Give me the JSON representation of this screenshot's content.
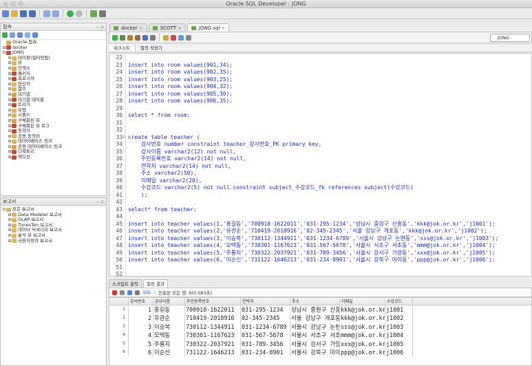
{
  "window": {
    "title": "Oracle SQL Developer : JONG"
  },
  "connections_panel": {
    "title": "접속",
    "tree": [
      {
        "label": "Oracle 접속",
        "level": 0,
        "toggle": "",
        "icon": "folder-icon"
      },
      {
        "label": "docker",
        "level": 0,
        "toggle": "+",
        "icon": "db-icon"
      },
      {
        "label": "JONG",
        "level": 0,
        "toggle": "-",
        "icon": "db-icon"
      },
      {
        "label": "테이블(필터링됨)",
        "level": 1,
        "toggle": "+",
        "icon": "folder-icon"
      },
      {
        "label": "뷰",
        "level": 1,
        "toggle": "+",
        "icon": "folder-icon"
      },
      {
        "label": "인덱스",
        "level": 1,
        "toggle": "+",
        "icon": "folder-icon"
      },
      {
        "label": "패키지",
        "level": 1,
        "toggle": "+",
        "icon": "folder-icon"
      },
      {
        "label": "프로시저",
        "level": 1,
        "toggle": "+",
        "icon": "folder-icon"
      },
      {
        "label": "연산자",
        "level": 1,
        "toggle": "+",
        "icon": "folder-icon"
      },
      {
        "label": "함수",
        "level": 1,
        "toggle": "+",
        "icon": "folder-icon"
      },
      {
        "label": "대기열",
        "level": 1,
        "toggle": "+",
        "icon": "folder-icon"
      },
      {
        "label": "대기열 테이블",
        "level": 1,
        "toggle": "+",
        "icon": "folder-icon"
      },
      {
        "label": "트리거",
        "level": 1,
        "toggle": "+",
        "icon": "folder-icon"
      },
      {
        "label": "유형",
        "level": 1,
        "toggle": "+",
        "icon": "folder-icon"
      },
      {
        "label": "시퀀스",
        "level": 1,
        "toggle": "+",
        "icon": "folder-icon"
      },
      {
        "label": "구체화된 뷰",
        "level": 1,
        "toggle": "+",
        "icon": "folder-icon"
      },
      {
        "label": "구체화된 뷰 로그",
        "level": 1,
        "toggle": "+",
        "icon": "folder-icon"
      },
      {
        "label": "동의어",
        "level": 1,
        "toggle": "+",
        "icon": "folder-icon"
      },
      {
        "label": "공용 동의어",
        "level": 1,
        "toggle": "+",
        "icon": "folder-icon"
      },
      {
        "label": "데이터베이스 링크",
        "level": 1,
        "toggle": "+",
        "icon": "folder-icon"
      },
      {
        "label": "공용 데이터베이스 링크",
        "level": 1,
        "toggle": "+",
        "icon": "folder-icon"
      },
      {
        "label": "디렉토리",
        "level": 1,
        "toggle": "+",
        "icon": "folder-icon"
      },
      {
        "label": "에디션",
        "level": 1,
        "toggle": "+",
        "icon": "folder-icon"
      }
    ]
  },
  "reports_panel": {
    "title": "보고서",
    "tree": [
      {
        "label": "모든 보고서",
        "level": 0,
        "toggle": "-"
      },
      {
        "label": "Data Modeler 보고서",
        "level": 1,
        "toggle": "+"
      },
      {
        "label": "OLAP 보고서",
        "level": 1,
        "toggle": "+"
      },
      {
        "label": "TimesTen 보고서",
        "level": 1,
        "toggle": "+"
      },
      {
        "label": "데이터 딕셔너리 보고서",
        "level": 1,
        "toggle": "+"
      },
      {
        "label": "분석 뷰 보고서",
        "level": 1,
        "toggle": "+"
      },
      {
        "label": "사용자정의 보고서",
        "level": 1,
        "toggle": "+"
      }
    ]
  },
  "editor_tabs": [
    {
      "label": "docker",
      "active": false
    },
    {
      "label": "SCOTT",
      "active": false
    },
    {
      "label": "JONG.sql",
      "active": true
    }
  ],
  "connection_select": "JONG",
  "editor_subtabs": [
    "워크시트",
    "질의 작성기"
  ],
  "code_lines": [
    {
      "n": "22",
      "fold": "",
      "text": ""
    },
    {
      "n": "23",
      "fold": "",
      "text": "insert into room values(901,34);"
    },
    {
      "n": "24",
      "fold": "",
      "text": "insert into room values(902,35);"
    },
    {
      "n": "25",
      "fold": "",
      "text": "insert into room values(903,25);"
    },
    {
      "n": "26",
      "fold": "",
      "text": "insert into room values(904,32);"
    },
    {
      "n": "27",
      "fold": "",
      "text": "insert into room values(905,30);"
    },
    {
      "n": "28",
      "fold": "",
      "text": "insert into room values(906,35);"
    },
    {
      "n": "29",
      "fold": "",
      "text": ""
    },
    {
      "n": "30",
      "fold": "",
      "text": "select * from room;"
    },
    {
      "n": "31",
      "fold": "",
      "text": ""
    },
    {
      "n": "32",
      "fold": "",
      "text": ""
    },
    {
      "n": "33",
      "fold": "⊟",
      "text": "create table teacher ("
    },
    {
      "n": "34",
      "fold": "",
      "text": "    강사번호 number constraint teacher_강사번호_PK primary key,"
    },
    {
      "n": "35",
      "fold": "",
      "text": "    강사이름 varchar2(12) not null,"
    },
    {
      "n": "36",
      "fold": "",
      "text": "    주민등록번호 varchar2(14) not null,"
    },
    {
      "n": "37",
      "fold": "",
      "text": "    연락처 varchar2(14) not null,"
    },
    {
      "n": "38",
      "fold": "",
      "text": "    주소 varchar2(50),"
    },
    {
      "n": "39",
      "fold": "",
      "text": "    이메일 varchar2(20),"
    },
    {
      "n": "40",
      "fold": "",
      "text": "    수강코드 varchar2(5) not null constraint subject_수강코드_fk references subject(수강코드)"
    },
    {
      "n": "41",
      "fold": "",
      "text": "    );"
    },
    {
      "n": "42",
      "fold": "",
      "text": ""
    },
    {
      "n": "43",
      "fold": "",
      "text": "select* from teacher;"
    },
    {
      "n": "44",
      "fold": "",
      "text": ""
    },
    {
      "n": "45",
      "fold": "",
      "text": "insert into teacher values(1,'홍길동','700918-1622011','031-295-1234','성남시 중원구 신흥동','kkk@jok.or.kr','j1001');"
    },
    {
      "n": "46",
      "fold": "",
      "text": "insert into teacher values(2,'유관순','710419-2018916','02-345-2345','서울 강남구 개포동','kkk@jok.or.kr','j1002');"
    },
    {
      "n": "47",
      "fold": "",
      "text": "insert into teacher values(3,'이승복','730112-1344911','031-1234-6789','서울시 강남구 논현동','sss@jok.or.kr','j1003');"
    },
    {
      "n": "48",
      "fold": "",
      "text": "insert into teacher values(4,'모택동','730301-1167623','031-567-5678','서울시 서초구 서초동','mmm@jok.or.kr','j1004');"
    },
    {
      "n": "49",
      "fold": "",
      "text": "insert into teacher values(5,'주룡지','730322-2037921','031-789-3456','서울시 강서구 가양동','xxx@jok.or.kr','j1005');"
    },
    {
      "n": "50",
      "fold": "",
      "text": "insert into teacher values(6,'이순신','731122-1646213','031-234-8901','서울시 강북구 미아동','ppp@jok.or.kr','j1006');"
    },
    {
      "n": "51",
      "fold": "",
      "text": ""
    },
    {
      "n": "52",
      "fold": "",
      "text": ""
    },
    {
      "n": "53",
      "fold": "",
      "text": "create"
    }
  ],
  "result_tabs": [
    {
      "label": "스크립트 출력",
      "active": false
    },
    {
      "label": "질의 결과",
      "active": true
    }
  ],
  "result_toolbar": {
    "sql_label": "SQL",
    "status": "인출된 모든 행: 6(0.083초)"
  },
  "grid": {
    "columns": [
      "강사번호",
      "강사이름",
      "주민등록번호",
      "연락처",
      "주소",
      "이메일",
      "수강코드"
    ],
    "rows": [
      [
        "1",
        "1",
        "홍길동",
        "700918-1622011",
        "031-295-1234",
        "성남시 중원구 신흥동",
        "kkk@jok.or.kr",
        "j1001"
      ],
      [
        "2",
        "2",
        "유관순",
        "710419-2018916",
        "02-345-2345",
        "서울 강남구 개포동",
        "kkk@jok.or.kr",
        "j1002"
      ],
      [
        "3",
        "3",
        "이승복",
        "730112-1344911",
        "031-1234-6789",
        "서울시 강남구 논현동",
        "sss@jok.or.kr",
        "j1003"
      ],
      [
        "4",
        "4",
        "모택동",
        "730301-1167623",
        "031-567-5678",
        "서울시 서초구 서초동",
        "mmm@jok.or.kr",
        "j1004"
      ],
      [
        "5",
        "5",
        "주룡지",
        "730322-2037921",
        "031-789-3456",
        "서울시 강서구 가양동",
        "xxx@jok.or.kr",
        "j1005"
      ],
      [
        "6",
        "6",
        "이순신",
        "731122-1646213",
        "031-234-8901",
        "서울시 강북구 미아동",
        "ppp@jok.or.kr",
        "j1006"
      ]
    ]
  },
  "colors": {
    "keyword": "#1a2aa8",
    "accent": "#3c6fd1"
  }
}
